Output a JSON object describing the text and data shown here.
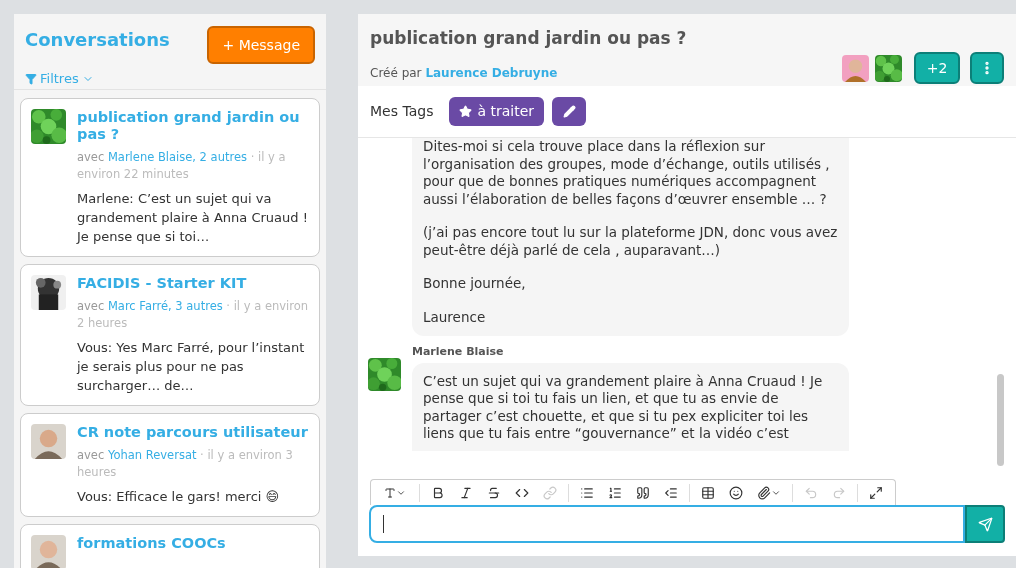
{
  "sidebar": {
    "title": "Conversations",
    "new_button": "+ Message",
    "filter": "Filtres",
    "conversations": [
      {
        "title": "publication grand jardin ou pas ?",
        "avec": "avec",
        "participants": "Marlene Blaise, 2 autres",
        "time": "· il y a environ 22 minutes",
        "preview": "Marlene: C’est un sujet qui va grandement plaire à Anna Cruaud ! Je pense que si toi…"
      },
      {
        "title": "FACIDIS - Starter KIT",
        "avec": "avec",
        "participants": "Marc Farré, 3 autres",
        "time": "· il y a environ 2 heures",
        "preview": "Vous: Yes Marc Farré, pour l’instant je serais plus pour ne pas surcharger… de…"
      },
      {
        "title": "CR note parcours utilisateur",
        "avec": "avec",
        "participants": "Yohan Reversat",
        "time": "· il y a environ 3 heures",
        "preview": "Vous: Efficace le gars! merci 😄"
      },
      {
        "title": "formations COOCs"
      }
    ]
  },
  "conversation": {
    "title": "publication grand jardin ou pas ?",
    "created_label": "Créé par",
    "author": "Laurence Debruyne",
    "more_participants": "+2",
    "tags_label": "Mes Tags",
    "tags": [
      "à traiter"
    ],
    "messages": [
      {
        "paragraphs": [
          "Dites-moi si cela trouve place dans la réflexion sur l’organisation des groupes, mode d’échange, outils utilisés , pour que de bonnes pratiques numériques accompagnent aussi l’élaboration de belles façons d’œuvrer ensemble … ?",
          "(j’ai pas encore tout lu sur la plateforme JDN, donc vous avez peut-être déjà parlé de cela , auparavant…)",
          "Bonne journée,",
          "Laurence"
        ]
      },
      {
        "author": "Marlene Blaise",
        "paragraphs": [
          "C’est un sujet qui va grandement plaire à Anna Cruaud ! Je pense que si toi tu fais un lien, et que tu as envie de partager c’est chouette, et que si tu pex expliciter toi les liens que tu fais entre “gouvernance” et la vidéo c’est"
        ]
      }
    ],
    "toolbar": [
      {
        "kind": "heading",
        "disabled": false
      },
      {
        "kind": "sep"
      },
      {
        "kind": "bold",
        "disabled": false
      },
      {
        "kind": "italic",
        "disabled": false
      },
      {
        "kind": "strike",
        "disabled": false
      },
      {
        "kind": "code",
        "disabled": false
      },
      {
        "kind": "link",
        "disabled": true
      },
      {
        "kind": "sep"
      },
      {
        "kind": "bullets",
        "disabled": false
      },
      {
        "kind": "numbers",
        "disabled": false
      },
      {
        "kind": "quote",
        "disabled": false
      },
      {
        "kind": "outdent",
        "disabled": false
      },
      {
        "kind": "sep"
      },
      {
        "kind": "table",
        "disabled": false
      },
      {
        "kind": "emoji",
        "disabled": false
      },
      {
        "kind": "attach",
        "disabled": false
      },
      {
        "kind": "sep"
      },
      {
        "kind": "undo",
        "disabled": true
      },
      {
        "kind": "redo",
        "disabled": true
      },
      {
        "kind": "sep"
      },
      {
        "kind": "fullscreen",
        "disabled": false
      }
    ]
  }
}
